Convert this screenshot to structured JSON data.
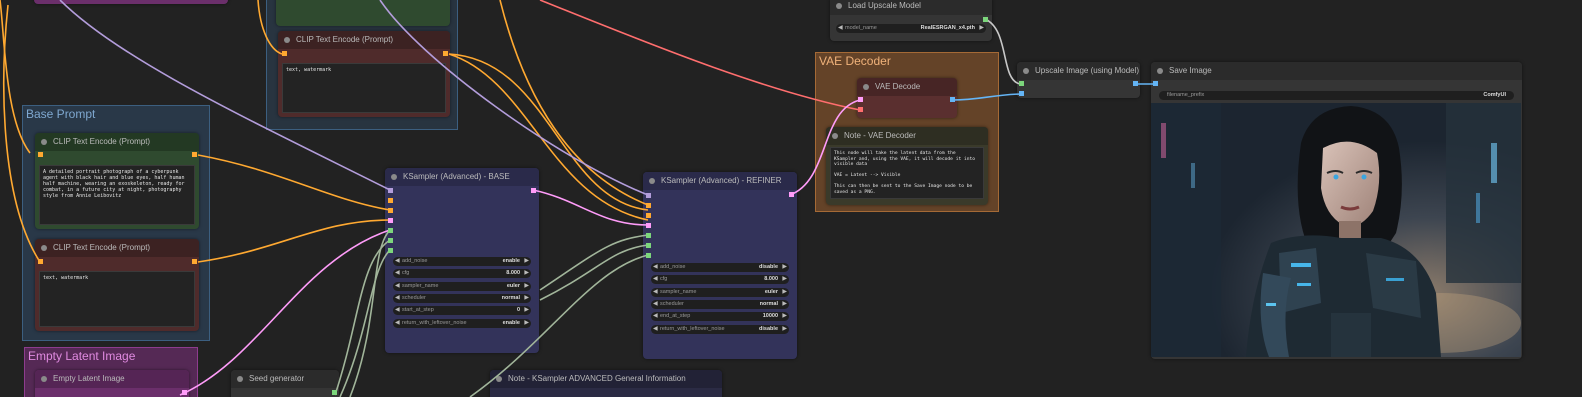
{
  "groups": {
    "base_prompt": "Base Prompt",
    "empty_latent": "Empty Latent Image",
    "vae_decoder": "VAE Decoder"
  },
  "nodes": {
    "clip_neg_top": {
      "title": "CLIP Text Encode (Prompt)",
      "text": "text, watermark"
    },
    "clip_pos_base": {
      "title": "CLIP Text Encode (Prompt)",
      "text": "A detailed portrait photograph of a cyberpunk agent with black hair and blue eyes, half human half machine, wearing an exoskeleton, ready for combat, in a future city at night, photography style from Annie Leibovitz"
    },
    "clip_neg_base": {
      "title": "CLIP Text Encode (Prompt)",
      "text": "text, watermark"
    },
    "empty_latent": {
      "title": "Empty Latent Image"
    },
    "seed_generator": {
      "title": "Seed generator"
    },
    "note_ksampler": {
      "title": "Note - KSampler  ADVANCED General Information"
    },
    "ksampler_base": {
      "title": "KSampler (Advanced) - BASE",
      "widgets": [
        {
          "label": "add_noise",
          "value": "enable"
        },
        {
          "label": "cfg",
          "value": "8.000"
        },
        {
          "label": "sampler_name",
          "value": "euler"
        },
        {
          "label": "scheduler",
          "value": "normal"
        },
        {
          "label": "start_at_step",
          "value": "0"
        },
        {
          "label": "return_with_leftover_noise",
          "value": "enable"
        }
      ]
    },
    "ksampler_refiner": {
      "title": "KSampler (Advanced) - REFINER",
      "widgets": [
        {
          "label": "add_noise",
          "value": "disable"
        },
        {
          "label": "cfg",
          "value": "8.000"
        },
        {
          "label": "sampler_name",
          "value": "euler"
        },
        {
          "label": "scheduler",
          "value": "normal"
        },
        {
          "label": "end_at_step",
          "value": "10000"
        },
        {
          "label": "return_with_leftover_noise",
          "value": "disable"
        }
      ]
    },
    "load_upscale": {
      "title": "Load Upscale Model",
      "widget_label": "model_name",
      "widget_value": "RealESRGAN_x4.pth"
    },
    "vae_decode": {
      "title": "VAE Decode"
    },
    "note_vae": {
      "title": "Note - VAE Decoder",
      "text": "This node will take the latent data from the KSampler and, using the VAE, it will decode it into visible data\n\nVAE = Latent --> Visible\n\nThis can then be sent to the Save Image node to be saved as a PNG."
    },
    "upscale_image": {
      "title": "Upscale Image (using Model)"
    },
    "save_image": {
      "title": "Save Image",
      "widget_label": "filename_prefix",
      "widget_value": "ComfyUI"
    }
  },
  "colors": {
    "canvas": "#222222",
    "wire_clip": "#FFA931",
    "wire_latent": "#FF9CF9",
    "wire_model": "#B39DDB",
    "wire_vae": "#FF6E6E",
    "wire_image": "#64B5F6",
    "wire_int": "#A1B59A",
    "wire_upscale": "#C8C8C8"
  }
}
